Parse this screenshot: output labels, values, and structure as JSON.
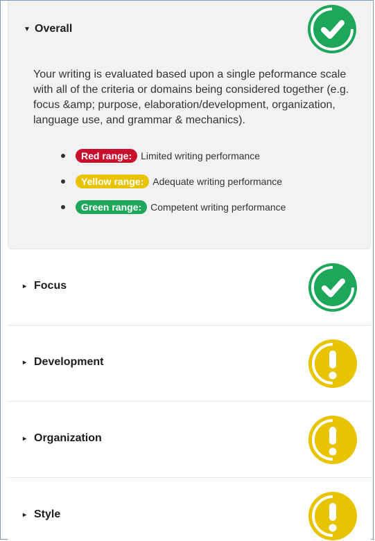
{
  "sections": {
    "overall": {
      "title": "Overall",
      "description": "Your writing is evaluated based upon a single peformance scale with all of the criteria or domains being considered together (e.g. focus &amp; purpose, elaboration/development, organization, language use, and grammar & mechanics).",
      "status_icon": "check-icon",
      "ranges": [
        {
          "label": "Red range:",
          "text": "Limited writing performance",
          "color": "#c8102e"
        },
        {
          "label": "Yellow range:",
          "text": "Adequate writing performance",
          "color": "#e8c300"
        },
        {
          "label": "Green range:",
          "text": "Competent writing performance",
          "color": "#1ea75a"
        }
      ]
    },
    "focus": {
      "title": "Focus",
      "status_icon": "check-icon"
    },
    "development": {
      "title": "Development",
      "status_icon": "exclamation-icon"
    },
    "organization": {
      "title": "Organization",
      "status_icon": "exclamation-icon"
    },
    "style": {
      "title": "Style",
      "status_icon": "exclamation-icon"
    }
  },
  "colors": {
    "green": "#1ea75a",
    "yellow": "#e8c300",
    "red": "#c8102e"
  }
}
